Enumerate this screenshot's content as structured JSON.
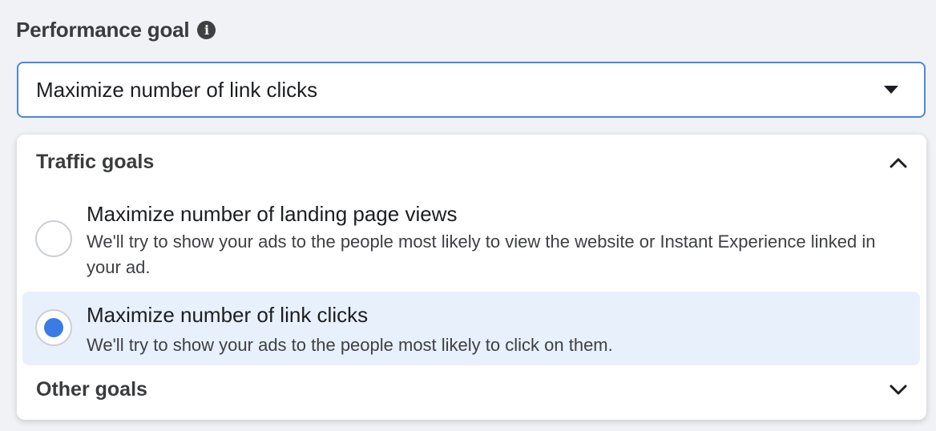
{
  "performance_goal": {
    "label": "Performance goal",
    "info_icon": "info-icon",
    "selected_value": "Maximize number of link clicks"
  },
  "dropdown": {
    "groups": [
      {
        "title": "Traffic goals",
        "expanded": true,
        "options": [
          {
            "title": "Maximize number of landing page views",
            "description": "We'll try to show your ads to the people most likely to view the website or Instant Experience linked in your ad.",
            "selected": false
          },
          {
            "title": "Maximize number of link clicks",
            "description": "We'll try to show your ads to the people most likely to click on them.",
            "selected": true
          }
        ]
      },
      {
        "title": "Other goals",
        "expanded": false
      }
    ]
  },
  "colors": {
    "accent": "#3b7be6",
    "select_border": "#4c85e6",
    "selected_row_bg": "#e8f0fc"
  }
}
